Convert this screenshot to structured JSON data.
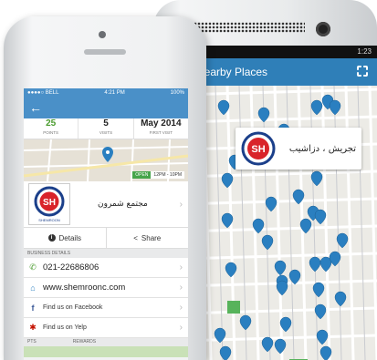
{
  "back_phone": {
    "status_time": "1:23",
    "header_title": "Nearby Places",
    "place_card_name": "تجریش ، دزاشیب",
    "logo_text": "SH",
    "colors": {
      "accent": "#2f7fb8",
      "marker": "#2a7fc0"
    }
  },
  "front_phone": {
    "status": {
      "carrier": "●●●●○ BELL",
      "time": "4:21 PM",
      "battery": "100%"
    },
    "stats": [
      {
        "value": "25",
        "label": "POINTS"
      },
      {
        "value": "5",
        "label": "VISITS"
      },
      {
        "value": "May 2014",
        "label": "FIRST VISIT"
      }
    ],
    "hours": {
      "open": "OPEN",
      "time": "12PM - 10PM"
    },
    "business_name": "مجتمع شمرون",
    "logo_text": "SH",
    "logo_sub": "SHEMROON",
    "actions": {
      "details": "Details",
      "share": "Share"
    },
    "section_business": "BUSINESS DETAILS",
    "phone": "021-22686806",
    "website": "www.shemroonc.com",
    "facebook": "Find us on Facebook",
    "yelp": "Find us on Yelp",
    "footer": {
      "pts": "PTS",
      "rewards": "REWARDS"
    }
  }
}
